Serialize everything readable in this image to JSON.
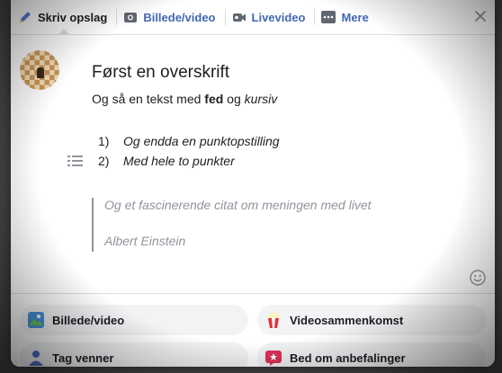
{
  "tabs": [
    {
      "label": "Skriv opslag",
      "icon": "pencil-icon"
    },
    {
      "label": "Billede/video",
      "icon": "camera-icon"
    },
    {
      "label": "Livevideo",
      "icon": "video-camera-icon"
    },
    {
      "label": "Mere",
      "icon": "more-dots-icon"
    }
  ],
  "post": {
    "heading": "Først en overskrift",
    "paragraph": {
      "prefix": "Og så en tekst med ",
      "bold": "fed",
      "middle": " og ",
      "italic": "kursiv"
    },
    "list": [
      {
        "number": "1)",
        "text": "Og endda en punktopstilling"
      },
      {
        "number": "2)",
        "text": "Med hele to punkter"
      }
    ],
    "quote": {
      "text": "Og et fascinerende citat om meningen med livet",
      "author": "Albert Einstein"
    }
  },
  "actions": [
    {
      "label": "Billede/video",
      "icon": "photo-icon"
    },
    {
      "label": "Videosammenkomst",
      "icon": "popcorn-icon"
    },
    {
      "label": "Tag venner",
      "icon": "tag-friends-icon"
    },
    {
      "label": "Bed om anbefalinger",
      "icon": "recommendation-icon"
    }
  ],
  "colors": {
    "link": "#4267b2",
    "text": "#1c1e21",
    "muted": "#90949c"
  }
}
